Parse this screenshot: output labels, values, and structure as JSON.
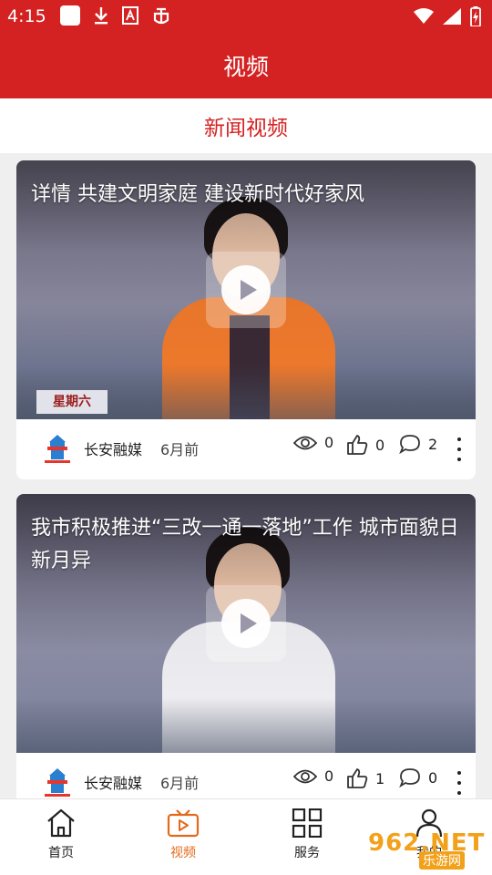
{
  "status_bar": {
    "time": "4:15",
    "icons": [
      "app-square-icon",
      "download-icon",
      "font-icon",
      "bug-icon",
      "wifi-icon",
      "signal-icon",
      "battery-icon"
    ]
  },
  "header": {
    "title": "视频"
  },
  "section": {
    "title": "新闻视频"
  },
  "colors": {
    "brand_red": "#d42222",
    "active_orange": "#e36a1c"
  },
  "videos": [
    {
      "title": "详情  共建文明家庭  建设新时代好家风",
      "date_tag": "星期六",
      "source": "长安融媒",
      "time_ago": "6月前",
      "views": "0",
      "likes": "0",
      "comments": "2"
    },
    {
      "title": "我市积极推进“三改一通一落地”工作  城市面貌日新月异",
      "source": "长安融媒",
      "time_ago": "6月前",
      "views": "0",
      "likes": "1",
      "comments": "0"
    }
  ],
  "bottom_nav": [
    {
      "label": "首页",
      "icon": "home-icon",
      "active": false
    },
    {
      "label": "视频",
      "icon": "tv-play-icon",
      "active": true
    },
    {
      "label": "服务",
      "icon": "grid-icon",
      "active": false
    },
    {
      "label": "我的",
      "icon": "user-icon",
      "active": false
    }
  ],
  "watermark": {
    "text": "962.NET",
    "sub": "乐游网"
  }
}
